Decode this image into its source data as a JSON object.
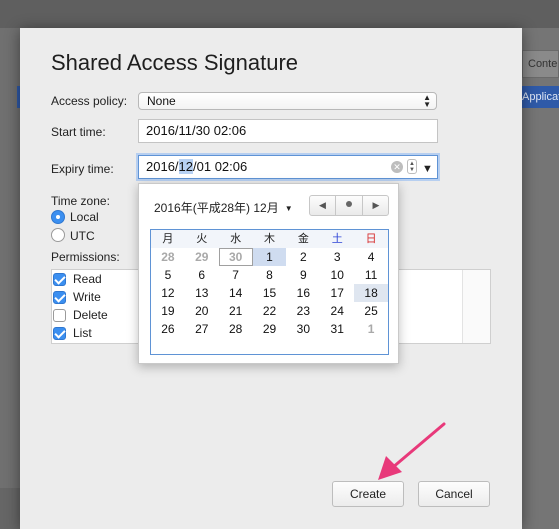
{
  "background": {
    "tab_partial": "Conte",
    "blue_item_partial": "Applicati"
  },
  "dialog": {
    "title": "Shared Access Signature",
    "access_policy": {
      "label": "Access policy:",
      "value": "None"
    },
    "start_time": {
      "label": "Start time:",
      "value": "2016/11/30 02:06"
    },
    "expiry_time": {
      "label": "Expiry time:",
      "value_before": "2016/",
      "value_selected": "12",
      "value_after": "/01 02:06"
    },
    "time_zone": {
      "label": "Time zone:",
      "options": [
        {
          "label": "Local",
          "checked": true
        },
        {
          "label": "UTC",
          "checked": false
        }
      ]
    },
    "permissions": {
      "label": "Permissions:",
      "items": [
        {
          "label": "Read",
          "checked": true
        },
        {
          "label": "Write",
          "checked": true
        },
        {
          "label": "Delete",
          "checked": false
        },
        {
          "label": "List",
          "checked": true
        }
      ]
    },
    "create_button": "Create",
    "cancel_button": "Cancel"
  },
  "calendar": {
    "month_label": "2016年(平成28年) 12月",
    "month_arrow": "▼",
    "nav_prev": "◀",
    "nav_next": "▶",
    "weekdays": [
      "月",
      "火",
      "水",
      "木",
      "金",
      "土",
      "日"
    ],
    "weeks": [
      [
        "28",
        "29",
        "30",
        "1",
        "2",
        "3",
        "4"
      ],
      [
        "5",
        "6",
        "7",
        "8",
        "9",
        "10",
        "11"
      ],
      [
        "12",
        "13",
        "14",
        "15",
        "16",
        "17",
        "18"
      ],
      [
        "19",
        "20",
        "21",
        "22",
        "23",
        "24",
        "25"
      ],
      [
        "26",
        "27",
        "28",
        "29",
        "30",
        "31",
        "1"
      ]
    ]
  },
  "colors": {
    "accent": "#3b8ff0",
    "focus_ring": "#5f93d5",
    "saturday": "#2d44d6",
    "sunday": "#d62d2d",
    "annotation_arrow": "#e8397a"
  }
}
